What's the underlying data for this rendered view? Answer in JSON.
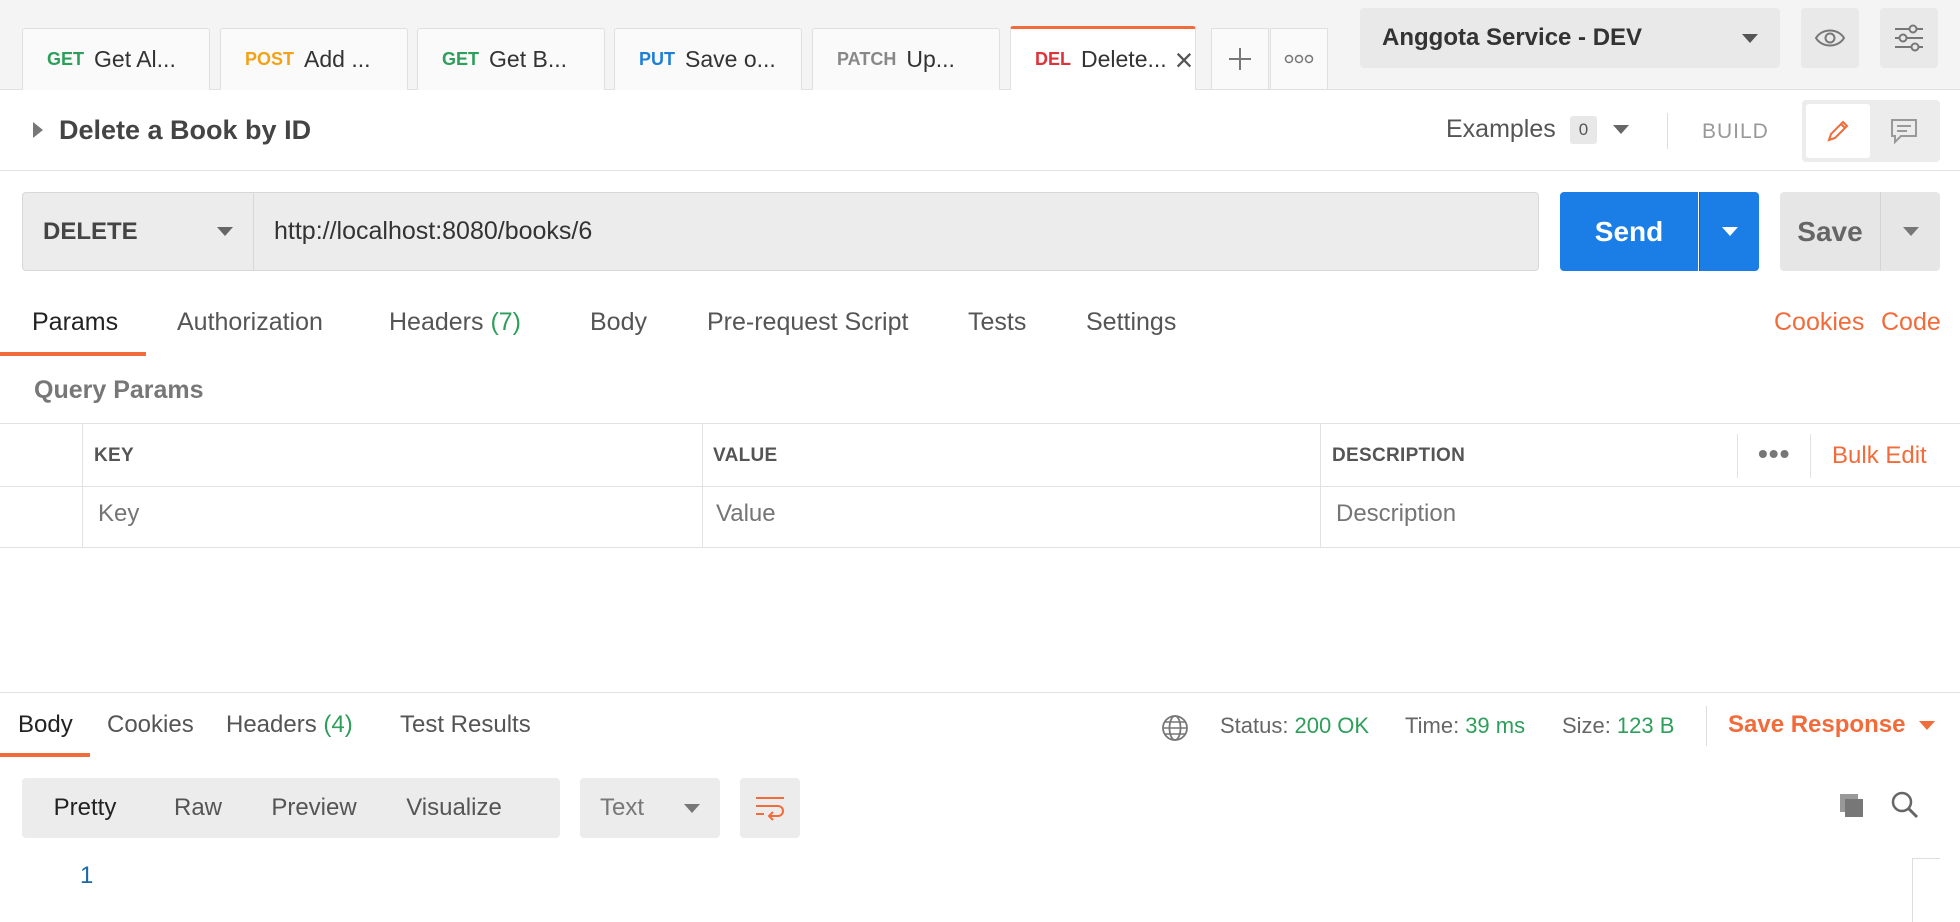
{
  "tabs": [
    {
      "method": "GET",
      "label": "Get Al...",
      "color": "#2e9e5b"
    },
    {
      "method": "POST",
      "label": "Add ...",
      "color": "#f2a216"
    },
    {
      "method": "GET",
      "label": "Get B...",
      "color": "#2e9e5b"
    },
    {
      "method": "PUT",
      "label": "Save o...",
      "color": "#1f7fd6",
      "unsaved": true
    },
    {
      "method": "PATCH",
      "label": "Up...",
      "color": "#888888"
    },
    {
      "method": "DEL",
      "label": "Delete...",
      "color": "#e0323a",
      "active": true
    }
  ],
  "environment": {
    "selected": "Anggota Service - DEV"
  },
  "request": {
    "title": "Delete a Book by ID",
    "examples_label": "Examples",
    "examples_count": "0",
    "build_label": "BUILD",
    "method": "DELETE",
    "url": "http://localhost:8080/books/6",
    "send_label": "Send",
    "save_label": "Save"
  },
  "request_tabs": {
    "params": "Params",
    "authorization": "Authorization",
    "headers": "Headers",
    "headers_count": "(7)",
    "body": "Body",
    "prerequest": "Pre-request Script",
    "tests": "Tests",
    "settings": "Settings",
    "cookies": "Cookies",
    "code": "Code"
  },
  "query_params": {
    "label": "Query Params",
    "columns": [
      "KEY",
      "VALUE",
      "DESCRIPTION"
    ],
    "placeholders": {
      "key": "Key",
      "value": "Value",
      "description": "Description"
    },
    "bulk_edit": "Bulk Edit"
  },
  "response": {
    "tabs": {
      "body": "Body",
      "cookies": "Cookies",
      "headers": "Headers",
      "headers_count": "(4)",
      "test_results": "Test Results"
    },
    "status_label": "Status:",
    "status_value": "200 OK",
    "time_label": "Time:",
    "time_value": "39 ms",
    "size_label": "Size:",
    "size_value": "123 B",
    "save_response": "Save Response",
    "view_modes": [
      "Pretty",
      "Raw",
      "Preview",
      "Visualize"
    ],
    "active_view": "Pretty",
    "format": "Text",
    "line_number": "1"
  },
  "colors": {
    "accent": "#f26b3a",
    "primary": "#1a7ee6",
    "success": "#2e9e5b"
  }
}
